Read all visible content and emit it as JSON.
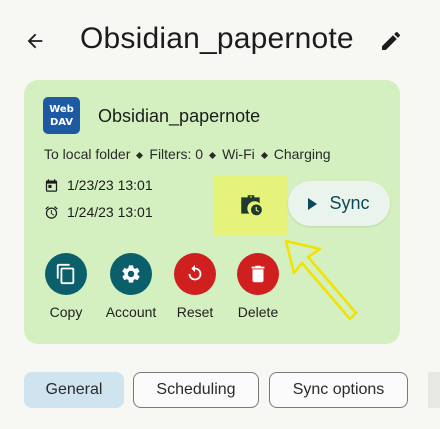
{
  "header": {
    "title": "Obsidian_papernote",
    "back_icon": "arrow-left-icon",
    "edit_icon": "pencil-icon"
  },
  "card": {
    "badge": {
      "line1": "Web",
      "line2": "DAV",
      "color": "#1e5aa3"
    },
    "name": "Obsidian_papernote",
    "info": {
      "target": "To local folder",
      "filters": "Filters: 0",
      "network": "Wi-Fi",
      "power": "Charging"
    },
    "last_sync": {
      "icon": "calendar-icon",
      "value": "1/23/23 13:01"
    },
    "next_sync": {
      "icon": "alarm-clock-icon",
      "value": "1/24/23 13:01"
    },
    "status_icon": "briefcase-clock-icon",
    "sync_button": "Sync",
    "actions": [
      {
        "label": "Copy",
        "icon": "copy-icon",
        "color": "#0b5f6b"
      },
      {
        "label": "Account",
        "icon": "gear-icon",
        "color": "#0b5f6b"
      },
      {
        "label": "Reset",
        "icon": "reset-icon",
        "color": "#cf1f1f"
      },
      {
        "label": "Delete",
        "icon": "trash-icon",
        "color": "#cf1f1f"
      }
    ],
    "background": "#d5f0c0",
    "highlight_color": "#e6f37a"
  },
  "tabs": [
    {
      "label": "General",
      "active": true
    },
    {
      "label": "Scheduling",
      "active": false
    },
    {
      "label": "Sync options",
      "active": false
    }
  ]
}
